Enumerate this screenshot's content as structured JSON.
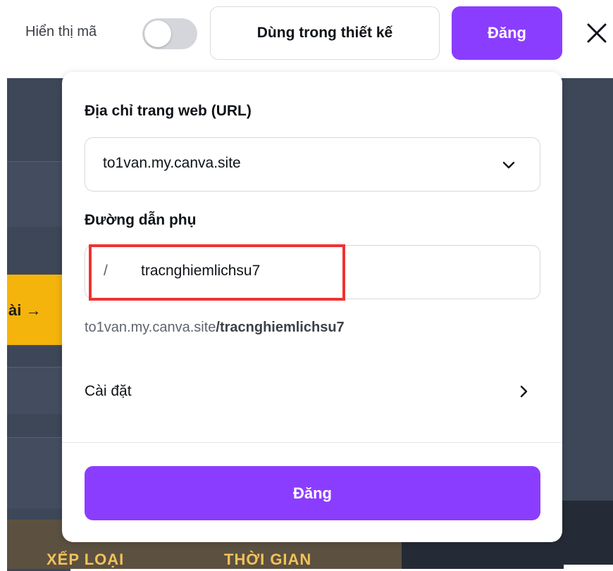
{
  "topbar": {
    "show_code_label": "Hiển thị mã",
    "show_code_enabled": false,
    "use_in_design_label": "Dùng trong thiết kế",
    "publish_label": "Đăng",
    "close_icon": "close-icon"
  },
  "background": {
    "cta_text": "ài →",
    "column_1": "XẾP LOẠI",
    "column_2": "THỜI GIAN"
  },
  "popover": {
    "url_label": "Địa chỉ trang web (URL)",
    "url_value": "to1van.my.canva.site",
    "subpath_label": "Đường dẫn phụ",
    "subpath_slash": "/",
    "subpath_value": "tracnghiemlichsu7",
    "preview_base": "to1van.my.canva.site",
    "preview_path": "/tracnghiemlichsu7",
    "settings_label": "Cài đặt",
    "publish_label": "Đăng"
  },
  "colors": {
    "accent": "#8b3dff",
    "highlight": "#ee3332",
    "cta_yellow": "#f5b40b"
  }
}
